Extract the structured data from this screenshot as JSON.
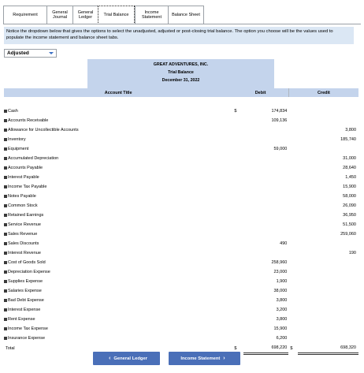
{
  "tabs": [
    {
      "label": "Requirement",
      "active": false
    },
    {
      "label": "General Journal",
      "active": false
    },
    {
      "label": "General Ledger",
      "active": false
    },
    {
      "label": "Trial Balance",
      "active": true
    },
    {
      "label": "Income Statement",
      "active": false
    },
    {
      "label": "Balance Sheet",
      "active": false
    }
  ],
  "notice": "Notice the dropdown below that gives the options to select the unadjusted, adjusted or post-closing trial balance. The option you choose will be the values used to populate the income statement and balance sheet tabs.",
  "dropdown": {
    "selected": "Adjusted"
  },
  "report": {
    "company": "GREAT ADVENTURES, INC.",
    "title": "Trial Balance",
    "date": "December 31, 2022",
    "col_account": "Account Title",
    "col_debit": "Debit",
    "col_credit": "Credit"
  },
  "rows": [
    {
      "account": "Cash",
      "dsign": "$",
      "debit": "174,834",
      "csign": "",
      "credit": ""
    },
    {
      "account": "Accounts Receivable",
      "dsign": "",
      "debit": "109,136",
      "csign": "",
      "credit": ""
    },
    {
      "account": "Allowance for Uncollectible Accounts",
      "dsign": "",
      "debit": "",
      "csign": "",
      "credit": "3,800"
    },
    {
      "account": "Inventory",
      "dsign": "",
      "debit": "",
      "csign": "",
      "credit": "185,740"
    },
    {
      "account": "Equipment",
      "dsign": "",
      "debit": "59,000",
      "csign": "",
      "credit": ""
    },
    {
      "account": "Accumulated Depreciation",
      "dsign": "",
      "debit": "",
      "csign": "",
      "credit": "31,000"
    },
    {
      "account": "Accounts Payable",
      "dsign": "",
      "debit": "",
      "csign": "",
      "credit": "28,640"
    },
    {
      "account": "Interest Payable",
      "dsign": "",
      "debit": "",
      "csign": "",
      "credit": "1,450"
    },
    {
      "account": "Income Tax Payable",
      "dsign": "",
      "debit": "",
      "csign": "",
      "credit": "15,900"
    },
    {
      "account": "Notes Payable",
      "dsign": "",
      "debit": "",
      "csign": "",
      "credit": "58,000"
    },
    {
      "account": "Common Stock",
      "dsign": "",
      "debit": "",
      "csign": "",
      "credit": "26,090"
    },
    {
      "account": "Retained Earnings",
      "dsign": "",
      "debit": "",
      "csign": "",
      "credit": "36,950"
    },
    {
      "account": "Service Revenue",
      "dsign": "",
      "debit": "",
      "csign": "",
      "credit": "51,500"
    },
    {
      "account": "Sales Revenue",
      "dsign": "",
      "debit": "",
      "csign": "",
      "credit": "259,060"
    },
    {
      "account": "Sales Discounts",
      "dsign": "",
      "debit": "490",
      "csign": "",
      "credit": ""
    },
    {
      "account": "Interest Revenue",
      "dsign": "",
      "debit": "",
      "csign": "",
      "credit": "190"
    },
    {
      "account": "Cost of Goods Sold",
      "dsign": "",
      "debit": "258,960",
      "csign": "",
      "credit": ""
    },
    {
      "account": "Depreciation Expense",
      "dsign": "",
      "debit": "23,000",
      "csign": "",
      "credit": ""
    },
    {
      "account": "Supplies Expense",
      "dsign": "",
      "debit": "1,900",
      "csign": "",
      "credit": ""
    },
    {
      "account": "Salaries Expense",
      "dsign": "",
      "debit": "38,000",
      "csign": "",
      "credit": ""
    },
    {
      "account": "Bad Debt Expense",
      "dsign": "",
      "debit": "3,800",
      "csign": "",
      "credit": ""
    },
    {
      "account": "Interest Expense",
      "dsign": "",
      "debit": "3,200",
      "csign": "",
      "credit": ""
    },
    {
      "account": "Rent Expense",
      "dsign": "",
      "debit": "3,800",
      "csign": "",
      "credit": ""
    },
    {
      "account": "Income Tax Expense",
      "dsign": "",
      "debit": "15,900",
      "csign": "",
      "credit": ""
    },
    {
      "account": "Insurance Expense",
      "dsign": "",
      "debit": "6,200",
      "csign": "",
      "credit": ""
    }
  ],
  "total": {
    "label": "Total",
    "dsign": "$",
    "debit": "698,220",
    "csign": "$",
    "credit": "698,320"
  },
  "nav": {
    "prev_label": "General Ledger",
    "next_label": "Income Statement"
  },
  "colors": {
    "header_blue": "#c4d4ec",
    "notice_blue": "#dbe7f4",
    "button_blue": "#4a6fb8"
  }
}
